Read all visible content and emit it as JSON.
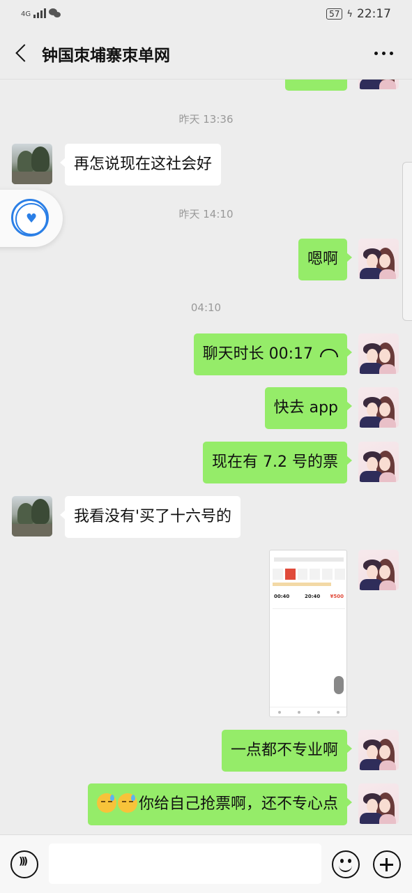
{
  "status_bar": {
    "network": "4G",
    "battery": "57",
    "time": "22:17"
  },
  "header": {
    "title": "钟国朿埔寨朿单网"
  },
  "messages": [
    {
      "type": "timestamp",
      "text": "昨天 13:36"
    },
    {
      "type": "text",
      "sender": "other",
      "text": "再怎说现在这社会好"
    },
    {
      "type": "timestamp",
      "text": "昨天 14:10"
    },
    {
      "type": "text",
      "sender": "self",
      "text": "嗯啊"
    },
    {
      "type": "timestamp",
      "text": "04:10"
    },
    {
      "type": "call",
      "sender": "self",
      "text": "聊天时长 00:17",
      "icon": "phone-hangup-icon"
    },
    {
      "type": "text",
      "sender": "self",
      "text": "快去 app"
    },
    {
      "type": "text",
      "sender": "self",
      "text": "现在有 7.2 号的票"
    },
    {
      "type": "text",
      "sender": "other",
      "text": "我看没有'买了十六号的"
    },
    {
      "type": "image",
      "sender": "self",
      "description_icon": "train-ticket-screenshot"
    },
    {
      "type": "text",
      "sender": "self",
      "text": "一点都不专业啊"
    },
    {
      "type": "text",
      "sender": "self",
      "emoji_count": 2,
      "text": "你给自己抢票啊，还不专心点"
    }
  ],
  "thumbnail": {
    "row_time_depart": "00:40",
    "row_time_arrive": "20:40",
    "row_price": "¥500"
  },
  "colors": {
    "self_bubble": "#95ec69",
    "other_bubble": "#ffffff",
    "background": "#ededed",
    "accent_blue": "#2b7fe6"
  }
}
